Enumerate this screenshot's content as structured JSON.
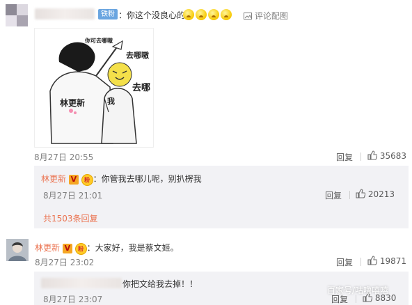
{
  "main_comment": {
    "fan_badge": "铁粉",
    "text": "：你这个没良心的",
    "emoji_count": 4,
    "action_label": "评论配图",
    "meme": {
      "top_text": "你可去哪嗷",
      "mid_text": "去哪嗷",
      "right_text": "去哪",
      "person_left_label": "林更新",
      "person_right_label": "我"
    },
    "date": "8月27日 20:55",
    "reply_label": "回复",
    "likes": "35683"
  },
  "sub_reply": {
    "author": "林更新",
    "text": "：你管我去哪儿呢，别扒楞我",
    "date": "8月27日 21:01",
    "reply_label": "回复",
    "likes": "20213",
    "more_label": "共1503条回复"
  },
  "second_comment": {
    "author": "林更新",
    "text": "：大家好，我是蔡文姬。",
    "date": "8月27日 23:02",
    "reply_label": "回复",
    "likes": "19871"
  },
  "third_reply": {
    "text": "你把文给我去掉！！",
    "date": "8月27日 23:07",
    "reply_label": "回复",
    "likes": "8830"
  },
  "badges": {
    "verified": "V",
    "crown": "粉"
  },
  "watermark": "百家号/咕噜嘻嘻",
  "colors": {
    "name": "#eb7350",
    "badge_blue": "#6aa5e0",
    "reply_bg": "#f2f2f5"
  }
}
